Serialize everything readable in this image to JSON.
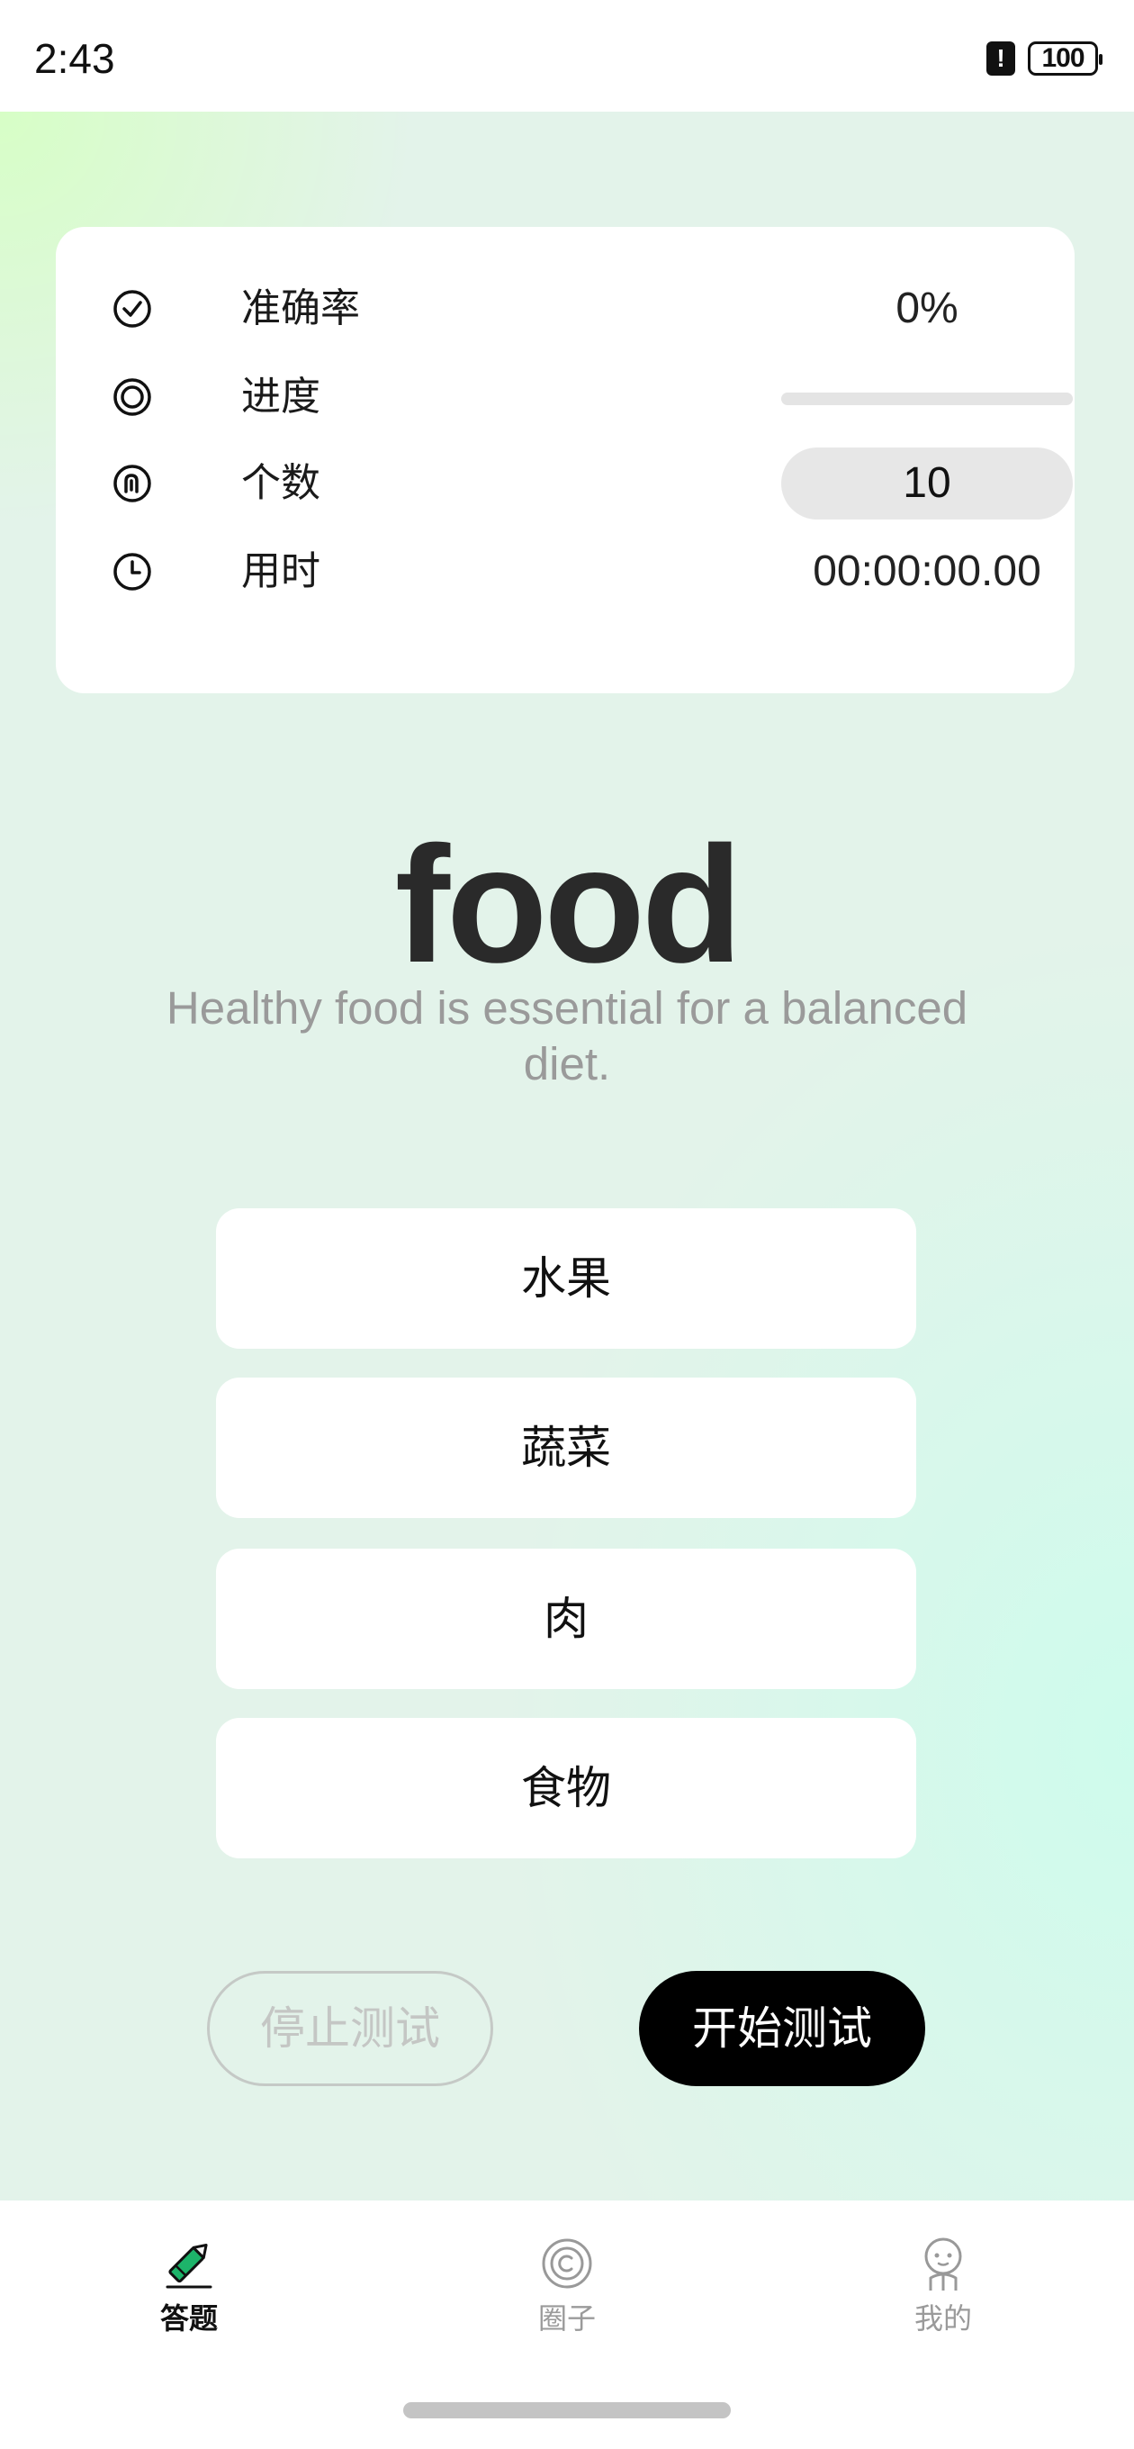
{
  "status_bar": {
    "time": "2:43",
    "battery": "100",
    "alert_icon": "alert-icon"
  },
  "stats": {
    "accuracy_label": "准确率",
    "accuracy_value": "0%",
    "progress_label": "进度",
    "progress_fraction": 0,
    "count_label": "个数",
    "count_value": "10",
    "time_label": "用时",
    "time_value": "00:00:00.00"
  },
  "word": {
    "title": "food",
    "sentence": "Healthy food is essential for a balanced diet."
  },
  "options": [
    "水果",
    "蔬菜",
    "肉",
    "食物"
  ],
  "controls": {
    "stop_label": "停止测试",
    "start_label": "开始测试"
  },
  "tabs": [
    {
      "label": "答题",
      "icon": "pencil-icon",
      "active": true
    },
    {
      "label": "圈子",
      "icon": "circle-icon",
      "active": false
    },
    {
      "label": "我的",
      "icon": "profile-icon",
      "active": false
    }
  ],
  "colors": {
    "accent": "#3ad07c",
    "start_button": "#000000",
    "background": "#e3f3ea"
  }
}
